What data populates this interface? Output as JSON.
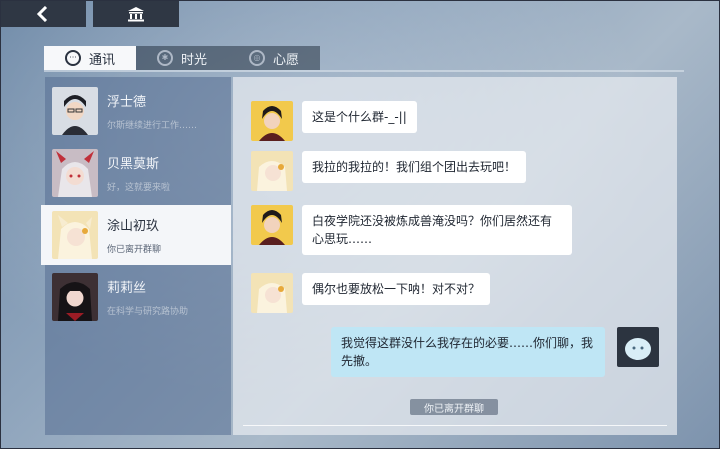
{
  "tabs": [
    {
      "label": "通讯",
      "icon": "chat-bubble-icon",
      "active": true
    },
    {
      "label": "时光",
      "icon": "gear-icon",
      "active": false
    },
    {
      "label": "心愿",
      "icon": "spiral-icon",
      "active": false
    }
  ],
  "contacts": [
    {
      "name": "浮士德",
      "preview": "尔斯继续进行工作……",
      "selected": false
    },
    {
      "name": "贝黑莫斯",
      "preview": "好，这就要来啦",
      "selected": false
    },
    {
      "name": "涂山初玖",
      "preview": "你已离开群聊",
      "selected": true
    },
    {
      "name": "莉莉丝",
      "preview": "在科学与研究路协助",
      "selected": false
    }
  ],
  "messages": [
    {
      "speaker": "dark-haired-boy",
      "text": "这是个什么群-_-||"
    },
    {
      "speaker": "fox-girl",
      "text": "我拉的我拉的！我们组个团出去玩吧！"
    },
    {
      "speaker": "dark-haired-boy",
      "text": "白夜学院还没被炼成兽淹没吗？你们居然还有心思玩……"
    },
    {
      "speaker": "fox-girl",
      "text": "偶尔也要放松一下呐！对不对？"
    },
    {
      "speaker": "me",
      "text": "我觉得这群没什么我存在的必要……你们聊，我先撤。"
    }
  ],
  "system_notice": "你已离开群聊",
  "colors": {
    "active_tab_bg": "#f7f8fa",
    "my_bubble": "#bfe6f5",
    "top_button": "#2f3744"
  }
}
